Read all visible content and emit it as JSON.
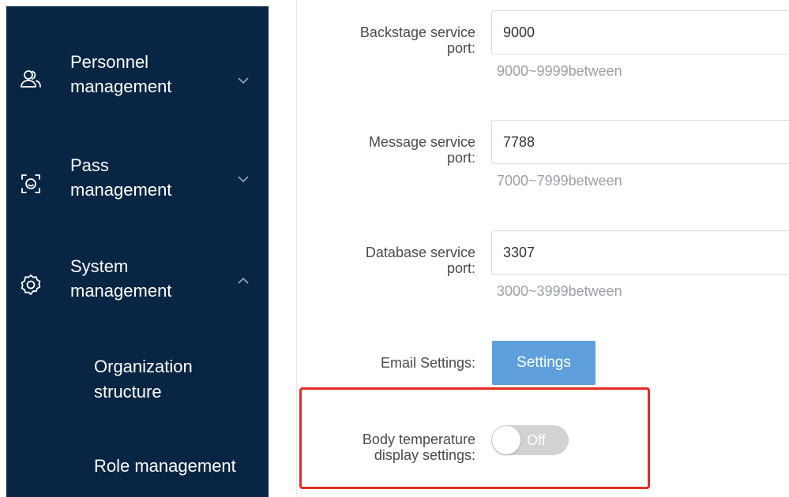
{
  "sidebar": {
    "items": [
      {
        "label": "Personnel\nmanagement",
        "icon": "users-icon",
        "chevron": "chevron-down-icon"
      },
      {
        "label": "Pass\nmanagement",
        "icon": "face-scan-icon",
        "chevron": "chevron-down-icon"
      },
      {
        "label": "System\nmanagement",
        "icon": "gear-icon",
        "chevron": "chevron-up-icon"
      }
    ],
    "subitems": [
      {
        "label": "Organization\nstructure"
      },
      {
        "label": "Role management"
      }
    ]
  },
  "form": {
    "backstage_port": {
      "label": "Backstage service\nport:",
      "value": "9000",
      "hint": "9000~9999between"
    },
    "message_port": {
      "label": "Message service\nport:",
      "value": "7788",
      "hint": "7000~7999between"
    },
    "database_port": {
      "label": "Database service\nport:",
      "value": "3307",
      "hint": "3000~3999between"
    },
    "email": {
      "label": "Email Settings:",
      "button_label": "Settings"
    },
    "body_temp": {
      "label": "Body temperature\ndisplay settings:",
      "toggle_text": "Off",
      "enabled": false
    }
  },
  "colors": {
    "sidebar_bg": "#082544",
    "primary_button": "#5e9fdc",
    "highlight_border": "#e22b25",
    "toggle_off": "#d2d2d2"
  }
}
